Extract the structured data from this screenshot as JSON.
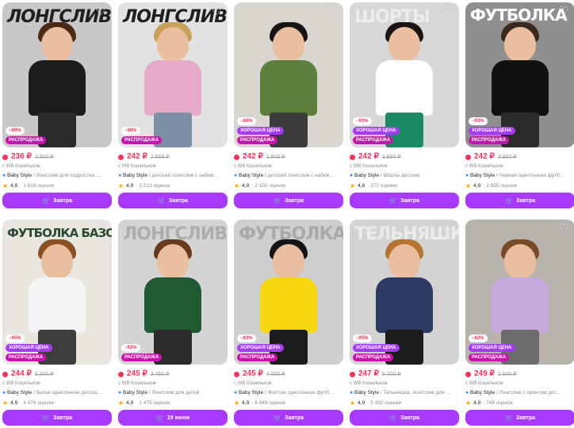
{
  "products": [
    {
      "bg_word": "ЛОНГСЛИВ",
      "bg_style": "dark",
      "photo_bg": "#c8c8c8",
      "shirt": "#1c1c1c",
      "pants": "#2a2a2a",
      "hair": "#4a2a17",
      "discount": "−89%",
      "labels": [
        "РАСПРОДАЖА"
      ],
      "price": "236 ₽",
      "old_price": "2 300 ₽",
      "wallet": "с WB Кошельком",
      "brand": "Baby Style",
      "desc": " / Лонгслив для подростка ...",
      "rating": "4,9",
      "reviews": "· 1 819 оценок",
      "button": "Завтра"
    },
    {
      "bg_word": "ЛОНГСЛИВ",
      "bg_style": "dark",
      "photo_bg": "#e2e2e2",
      "shirt": "#e6a9c8",
      "pants": "#7d8fa3",
      "hair": "#c9a25a",
      "discount": "−90%",
      "labels": [
        "РАСПРОДАЖА"
      ],
      "price": "242 ₽",
      "old_price": "2 558 ₽",
      "wallet": "с WB Кошельком",
      "brand": "Baby Style",
      "desc": " / детский лонгслив с набив...",
      "rating": "4,9",
      "reviews": "· 2 213 оценок",
      "button": "Завтра"
    },
    {
      "bg_word": "",
      "bg_style": "dark",
      "photo_bg": "#d9d6d0",
      "shirt": "#5d7f3c",
      "pants": "#3b3b3b",
      "hair": "#151515",
      "discount": "−86%",
      "labels": [
        "ХОРОШАЯ ЦЕНА",
        "РАСПРОДАЖА"
      ],
      "price": "242 ₽",
      "old_price": "1 800 ₽",
      "wallet": "с WB Кошельком",
      "brand": "Baby Style",
      "desc": " / детский лонгслив с набив...",
      "rating": "4,9",
      "reviews": "· 2 150 оценок",
      "button": "Завтра"
    },
    {
      "bg_word": "ШОРТЫ",
      "bg_style": "ghost",
      "photo_bg": "#d7d7d7",
      "shirt": "#ffffff",
      "pants": "#1a8a66",
      "hair": "#1c1410",
      "discount": "−93%",
      "labels": [
        "ХОРОШАЯ ЦЕНА",
        "РАСПРОДАЖА"
      ],
      "price": "242 ₽",
      "old_price": "3 950 ₽",
      "wallet": "с WB Кошельком",
      "brand": "Baby Style",
      "desc": " / Шорты детские",
      "rating": "4,8",
      "reviews": "· 372 оценки",
      "button": "Завтра"
    },
    {
      "bg_word": "ФУТБОЛКА",
      "bg_style": "white",
      "photo_bg": "#8f8f8f",
      "shirt": "#111111",
      "pants": "#2a2a2a",
      "hair": "#3a2a1c",
      "discount": "−93%",
      "labels": [
        "ХОРОШАЯ ЦЕНА",
        "РАСПРОДАЖА"
      ],
      "price": "242 ₽",
      "old_price": "3 950 ₽",
      "wallet": "с WB Кошельком",
      "brand": "Baby Style",
      "desc": " / Черная однотонная футб...",
      "rating": "4,9",
      "reviews": "· 2 855 оценок",
      "button": "Завтра"
    },
    {
      "bg_word": "ФУТБОЛКА БАЗОВАЯ",
      "bg_style": "green",
      "photo_bg": "#e9e6df",
      "shirt": "#f4f4f4",
      "pants": "#3d3d3d",
      "hair": "#8a4f25",
      "discount": "−95%",
      "labels": [
        "ХОРОШАЯ ЦЕНА",
        "РАСПРОДАЖА"
      ],
      "price": "244 ₽",
      "old_price": "5 300 ₽",
      "wallet": "с WB Кошельком",
      "brand": "Baby Style",
      "desc": " / белая однотонная детска...",
      "rating": "4,9",
      "reviews": "· 4 476 оценок",
      "button": "Завтра"
    },
    {
      "bg_word": "ЛОНГСЛИВ",
      "bg_style": "darkghost",
      "photo_bg": "#d4d4d4",
      "shirt": "#1f5a32",
      "pants": "#2b2b2b",
      "hair": "#6a3a1e",
      "discount": "−92%",
      "labels": [
        "РАСПРОДАЖА"
      ],
      "price": "245 ₽",
      "old_price": "3 450 ₽",
      "wallet": "с WB Кошельком",
      "brand": "Baby Style",
      "desc": " / Лонгслив для детей",
      "rating": "4,9",
      "reviews": "· 1 475 оценок",
      "button": "19 июня"
    },
    {
      "bg_word": "ФУТБОЛКА",
      "bg_style": "darkghost",
      "photo_bg": "#cfcfcf",
      "shirt": "#f5d70f",
      "pants": "#1c1c1c",
      "hair": "#151515",
      "discount": "−93%",
      "labels": [
        "ХОРОШАЯ ЦЕНА",
        "РАСПРОДАЖА"
      ],
      "price": "245 ₽",
      "old_price": "4 000 ₽",
      "wallet": "с WB Кошельком",
      "brand": "Baby Style",
      "desc": " / Желтая однотонная футб...",
      "rating": "4,9",
      "reviews": "· 6 949 оценок",
      "button": "Завтра"
    },
    {
      "bg_word": "ТЕЛЬНЯШКА",
      "bg_style": "ghost",
      "photo_bg": "#d3d3d3",
      "shirt": "#2d3a63",
      "pants": "#1c1c1c",
      "hair": "#b5742f",
      "discount": "−95%",
      "labels": [
        "ХОРОШАЯ ЦЕНА",
        "РАСПРОДАЖА"
      ],
      "price": "247 ₽",
      "old_price": "5 200 ₽",
      "wallet": "с WB Кошельком",
      "brand": "Baby Style",
      "desc": " / Тельняшка, лонгслив для ...",
      "rating": "4,9",
      "reviews": "· 5 392 оценки",
      "button": "Завтра"
    },
    {
      "bg_word": "",
      "bg_style": "ghost",
      "photo_bg": "#b9b3ad",
      "shirt": "#c6a9dd",
      "pants": "#6c6c6c",
      "hair": "#7a4a28",
      "discount": "−82%",
      "labels": [
        "ХОРОШАЯ ЦЕНА",
        "РАСПРОДАЖА"
      ],
      "price": "249 ₽",
      "old_price": "1 500 ₽",
      "wallet": "с WB Кошельком",
      "brand": "Baby Style",
      "desc": " / Лонгслив с принтом дет...",
      "rating": "4,9",
      "reviews": "· 749 оценок",
      "button": "Завтра"
    }
  ],
  "colors": {
    "accent": "#a73afd",
    "price": "#f5325b",
    "sale_badge": "#cb11ab",
    "star": "#ffa800"
  },
  "icons": {
    "favorite": "heart-outline-icon",
    "cart": "cart-icon",
    "verified": "check-badge-icon",
    "rating": "star-icon"
  }
}
